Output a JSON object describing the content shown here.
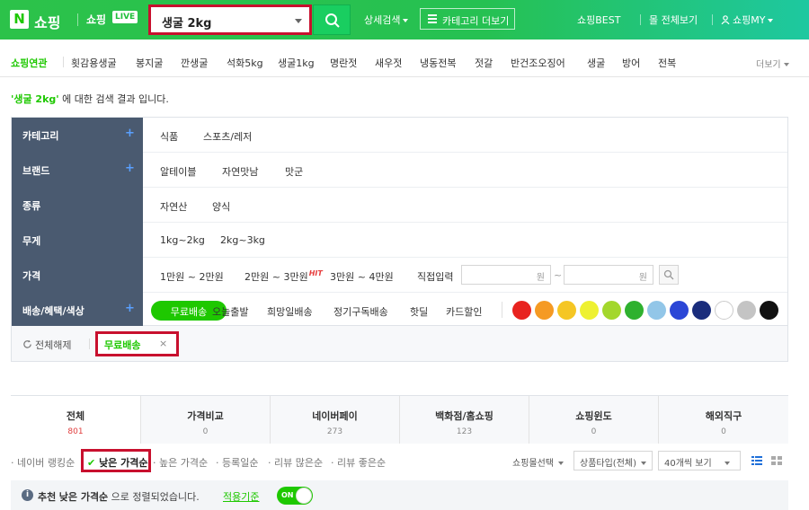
{
  "header": {
    "logo_letter": "N",
    "logo_text": "쇼핑",
    "live_text": "쇼핑",
    "live_badge": "LIVE",
    "search_value": "생굴 2kg",
    "detail_search": "상세검색",
    "category_more": "카테고리 더보기",
    "shopping_best": "쇼핑BEST",
    "mall_view": "몰 전체보기",
    "my_shopping": "쇼핑MY"
  },
  "related": {
    "label": "쇼핑연관",
    "items": [
      "횟감용생굴",
      "봉지굴",
      "깐생굴",
      "석화5kg",
      "생굴1kg",
      "명란젓",
      "새우젓",
      "냉동전복",
      "젓갈",
      "반건조오징어",
      "생굴",
      "방어",
      "전복"
    ],
    "more": "더보기"
  },
  "result": {
    "query": "'생굴 2kg'",
    "suffix": " 에 대한 검색 결과 입니다."
  },
  "filters": {
    "category": {
      "label": "카테고리",
      "items": [
        "식품",
        "스포츠/레저"
      ]
    },
    "brand": {
      "label": "브랜드",
      "items": [
        "알테이블",
        "자연맛남",
        "맛군"
      ]
    },
    "kind": {
      "label": "종류",
      "items": [
        "자연산",
        "양식"
      ]
    },
    "weight": {
      "label": "무게",
      "items": [
        "1kg~2kg",
        "2kg~3kg"
      ]
    },
    "price": {
      "label": "가격",
      "ranges": [
        "1만원 ~ 2만원",
        "2만원 ~ 3만원",
        "3만원 ~ 4만원"
      ],
      "hit": "HIT",
      "direct": "직접입력",
      "unit": "원",
      "sep": "~"
    },
    "delivery": {
      "label": "배송/혜택/색상",
      "active": "무료배송",
      "items": [
        "오늘출발",
        "희망일배송",
        "정기구독배송",
        "핫딜",
        "카드할인"
      ],
      "colors": [
        "#e8231f",
        "#f59a23",
        "#f5c624",
        "#eef131",
        "#a3d72c",
        "#2fb12f",
        "#92c6e8",
        "#2b46d6",
        "#1a2d7c",
        "#ffffff",
        "#c4c4c4",
        "#111111"
      ]
    }
  },
  "selected": {
    "reset": "전체해제",
    "tag": "무료배송",
    "remove": "×"
  },
  "tabs": [
    {
      "name": "전체",
      "count": "801"
    },
    {
      "name": "가격비교",
      "count": "0"
    },
    {
      "name": "네이버페이",
      "count": "273"
    },
    {
      "name": "백화점/홈쇼핑",
      "count": "123"
    },
    {
      "name": "쇼핑윈도",
      "count": "0"
    },
    {
      "name": "해외직구",
      "count": "0"
    }
  ],
  "sort": {
    "items": [
      "네이버 랭킹순",
      "낮은 가격순",
      "높은 가격순",
      "등록일순",
      "리뷰 많은순",
      "리뷰 좋은순"
    ],
    "mall_select": "쇼핑몰선택",
    "product_type": "상품타입(전체)",
    "per_page": "40개씩 보기"
  },
  "notice": {
    "info": "i",
    "prefix": "추천",
    "sort_name": "낮은 가격순",
    "suffix": " 으로 정렬되었습니다.",
    "link": "적용기준",
    "toggle": "ON"
  }
}
